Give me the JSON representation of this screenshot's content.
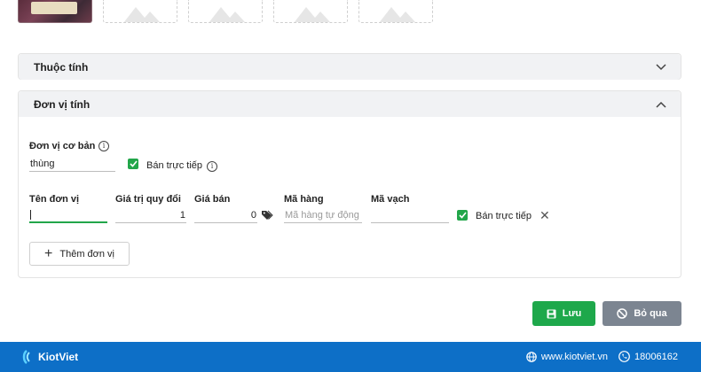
{
  "images": {
    "slots": [
      "photo",
      "empty",
      "empty",
      "empty",
      "empty"
    ]
  },
  "attributes_panel": {
    "title": "Thuộc tính"
  },
  "unit_panel": {
    "title": "Đơn vị tính",
    "base_unit_label": "Đơn vị cơ bản",
    "base_unit_value": "thùng",
    "direct_sale_label": "Bán trực tiếp",
    "columns": {
      "unit_name": "Tên đơn vị",
      "conversion": "Giá trị quy đổi",
      "price": "Giá bán",
      "code": "Mã hàng",
      "barcode": "Mã vạch"
    },
    "row": {
      "unit_name": "",
      "conversion": "1",
      "price": "0",
      "code_placeholder": "Mã hàng tự động",
      "barcode": "",
      "direct_sale_label": "Bán trực tiếp",
      "direct_sale_checked": true
    },
    "add_unit_label": "Thêm đơn vị"
  },
  "actions": {
    "save_label": "Lưu",
    "skip_label": "Bỏ qua"
  },
  "footer": {
    "brand": "KiotViet",
    "website": "www.kiotviet.vn",
    "phone": "18006162"
  },
  "colors": {
    "accent_green": "#1ea84b",
    "footer_blue": "#0d6fc7",
    "skip_gray": "#7c8591"
  }
}
